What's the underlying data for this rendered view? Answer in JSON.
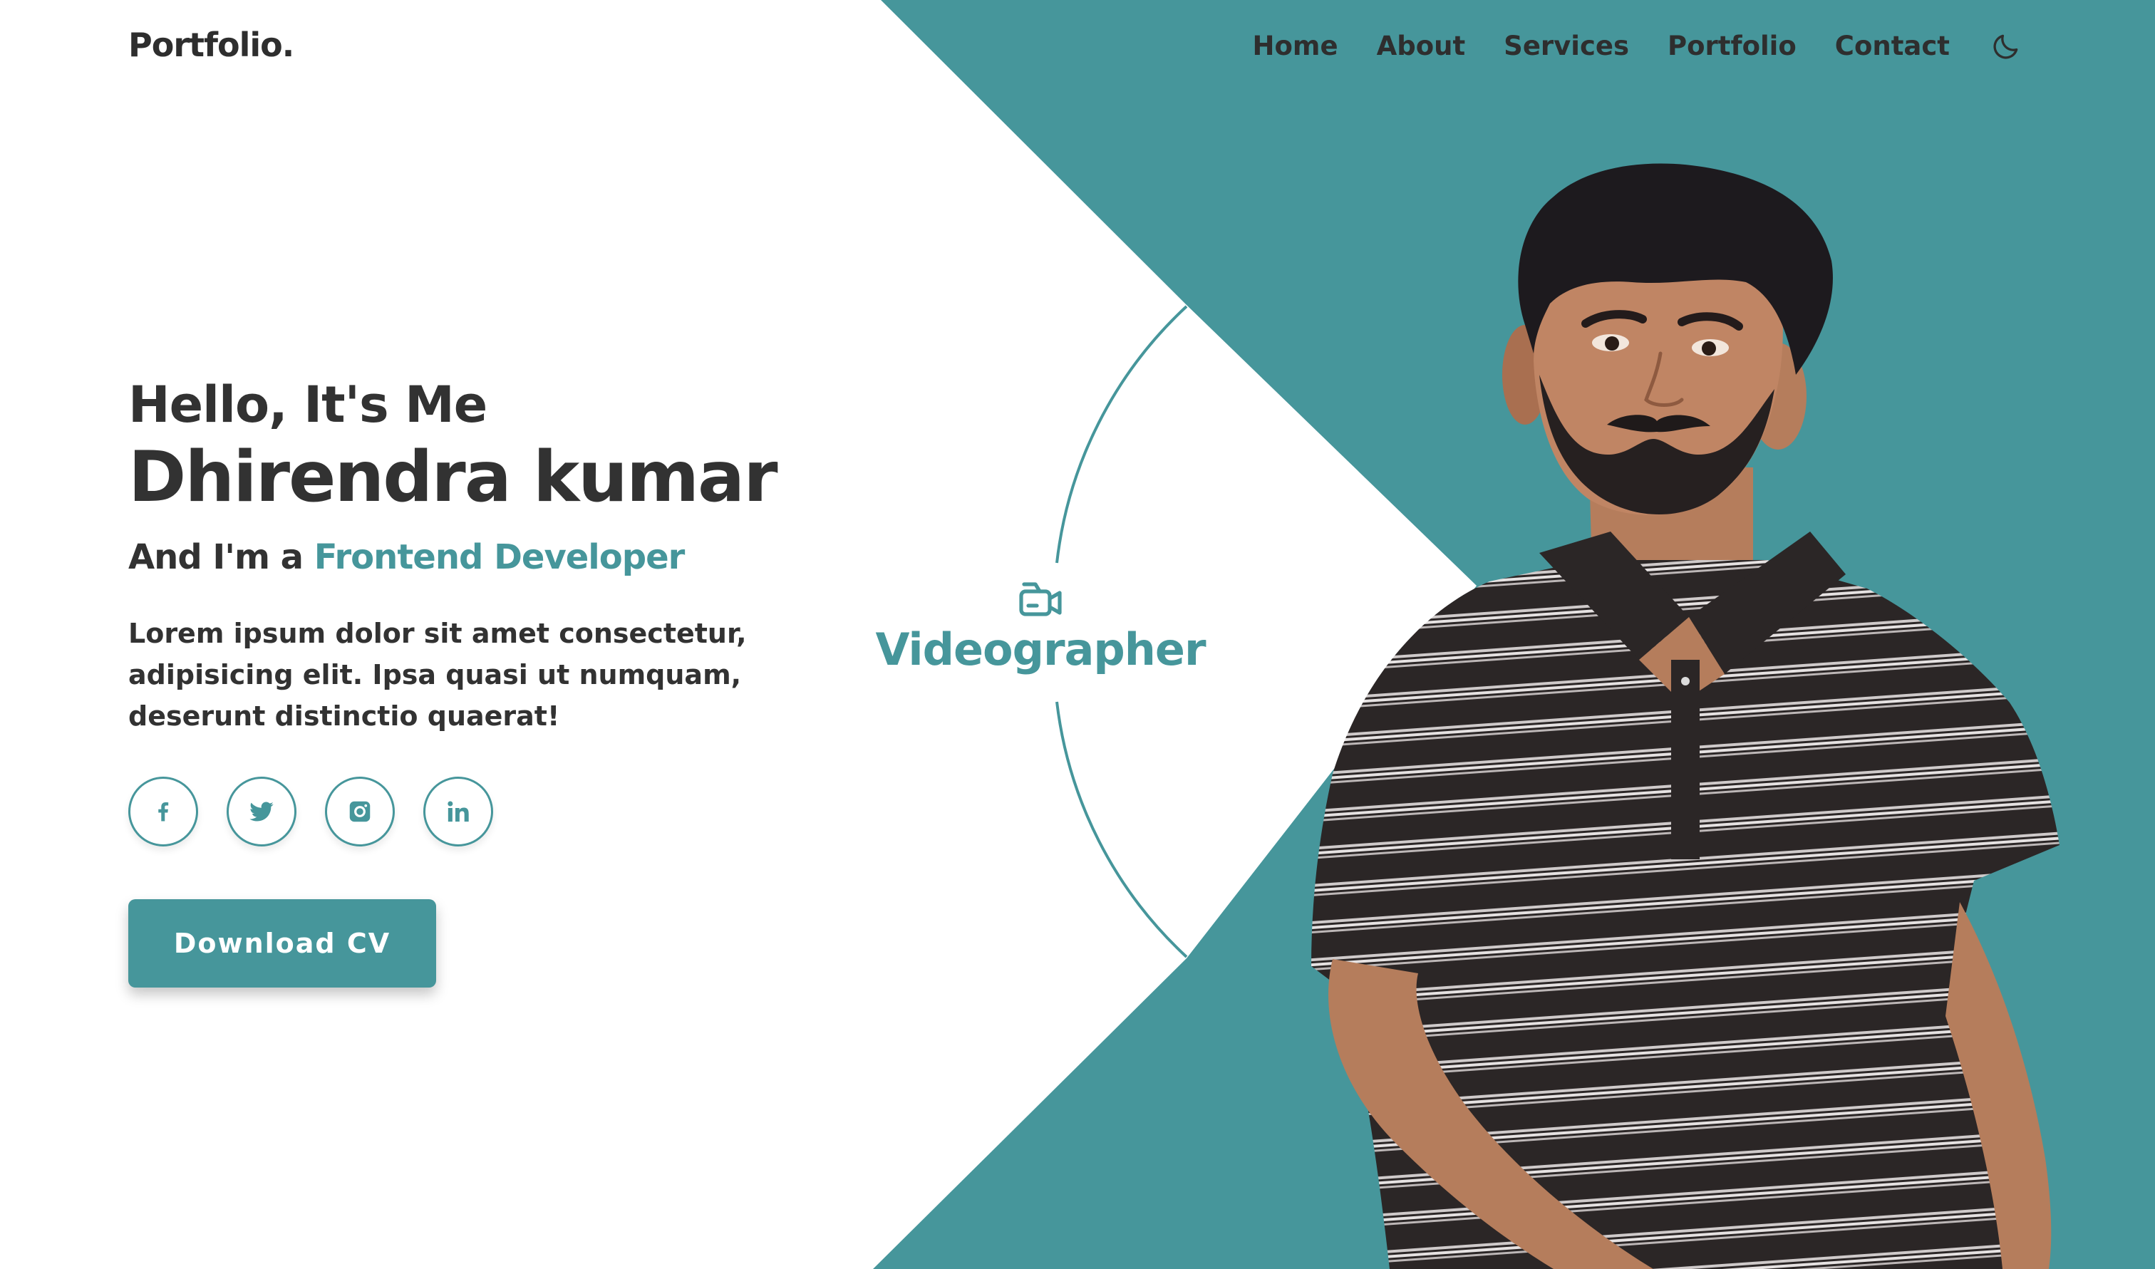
{
  "header": {
    "logo": "Portfolio.",
    "nav": {
      "home": "Home",
      "about": "About",
      "services": "Services",
      "portfolio": "Portfolio",
      "contact": "Contact"
    },
    "theme_toggle_icon": "moon-icon"
  },
  "hero": {
    "greeting": "Hello, It's Me",
    "name": "Dhirendra kumar",
    "role_prefix": "And I'm a",
    "role_highlight": "Frontend Developer",
    "description": "Lorem ipsum dolor sit amet consectetur, adipisicing elit. Ipsa quasi ut numquam, deserunt distinctio quaerat!",
    "socials": [
      {
        "icon": "facebook-icon"
      },
      {
        "icon": "twitter-icon"
      },
      {
        "icon": "instagram-icon"
      },
      {
        "icon": "linkedin-icon"
      }
    ],
    "download_label": "Download CV"
  },
  "service_badge": {
    "icon": "video-camera-icon",
    "label": "Videographer"
  },
  "portrait": {
    "icon": "person-photo"
  },
  "colors": {
    "accent": "#46969b",
    "text": "#323232",
    "background": "#ffffff"
  }
}
